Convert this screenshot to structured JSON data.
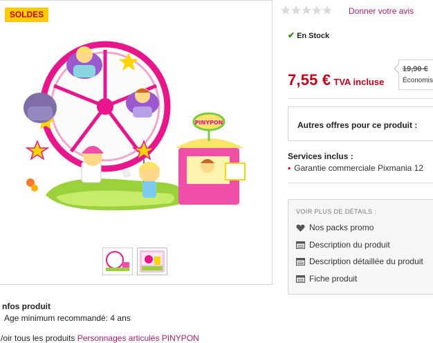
{
  "badge": {
    "label": "SOLDES"
  },
  "rating": {
    "review_link": "Donner votre avis"
  },
  "stock": {
    "label": "En Stock"
  },
  "price": {
    "current": "7,55 €",
    "tax_label": "TVA incluse",
    "old": "19,90 €",
    "saving_label": "Économis"
  },
  "offers": {
    "label": "Autres offres pour ce produit :"
  },
  "services": {
    "title": "Services inclus :",
    "item": "Garantie commerciale Pixmania 12"
  },
  "details": {
    "title": "VOIR PLUS DE DÉTAILS :",
    "items": [
      "Nos packs promo",
      "Description du produit",
      "Description détaillée du produit",
      "Fiche produit"
    ]
  },
  "info": {
    "title": "nfos produit",
    "age": "Age minimum recommandé: 4 ans",
    "see_all_prefix": "/oir tous les produits",
    "see_all_link": "Personnages articulés PINYPON"
  },
  "colors": {
    "accent_red": "#c4001a",
    "link_magenta": "#a6216f",
    "badge_yellow": "#ffcc00",
    "stock_green": "#2f8a00"
  }
}
